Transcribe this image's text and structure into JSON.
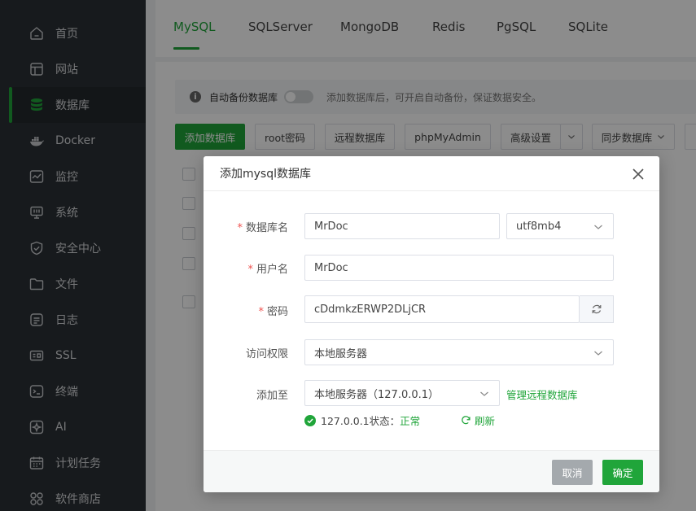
{
  "sidebar": {
    "items": [
      {
        "label": "首页",
        "icon": "home-icon"
      },
      {
        "label": "网站",
        "icon": "website-icon"
      },
      {
        "label": "数据库",
        "icon": "database-icon",
        "active": true
      },
      {
        "label": "Docker",
        "icon": "docker-icon"
      },
      {
        "label": "监控",
        "icon": "monitor-icon"
      },
      {
        "label": "系统",
        "icon": "system-icon"
      },
      {
        "label": "安全中心",
        "icon": "shield-icon"
      },
      {
        "label": "文件",
        "icon": "folder-icon"
      },
      {
        "label": "日志",
        "icon": "log-icon"
      },
      {
        "label": "SSL",
        "icon": "ssl-icon"
      },
      {
        "label": "终端",
        "icon": "terminal-icon"
      },
      {
        "label": "AI",
        "icon": "ai-icon"
      },
      {
        "label": "计划任务",
        "icon": "calendar-icon"
      },
      {
        "label": "软件商店",
        "icon": "app-store-icon"
      }
    ]
  },
  "tabs": [
    {
      "label": "MySQL",
      "active": true
    },
    {
      "label": "SQLServer"
    },
    {
      "label": "MongoDB"
    },
    {
      "label": "Redis"
    },
    {
      "label": "PgSQL"
    },
    {
      "label": "SQLite"
    }
  ],
  "info_bar": {
    "label": "自动备份数据库",
    "hint": "添加数据库后，可开启自动备份，保证数据安全。"
  },
  "toolbar": {
    "add_db": "添加数据库",
    "root_password": "root密码",
    "remote_db": "远程数据库",
    "phpmyadmin": "phpMyAdmin",
    "advanced": "高级设置",
    "sync_db": "同步数据库"
  },
  "modal": {
    "title": "添加mysql数据库",
    "db_name_label": "数据库名",
    "db_name_value": "MrDoc",
    "charset_value": "utf8mb4",
    "username_label": "用户名",
    "username_value": "MrDoc",
    "password_label": "密码",
    "password_value": "cDdmkzERWP2DLjCR",
    "access_label": "访问权限",
    "access_value": "本地服务器",
    "add_to_label": "添加至",
    "add_to_value": "本地服务器（127.0.0.1）",
    "manage_remote_link": "管理远程数据库",
    "status_prefix": "127.0.0.1状态：",
    "status_value": "正常",
    "refresh_label": "刷新",
    "cancel": "取消",
    "confirm": "确定"
  },
  "colors": {
    "accent": "#20a53a",
    "sidebar_bg": "#2b3035",
    "required_star": "#ef5350",
    "cancel_btn": "#a4a9ad"
  }
}
